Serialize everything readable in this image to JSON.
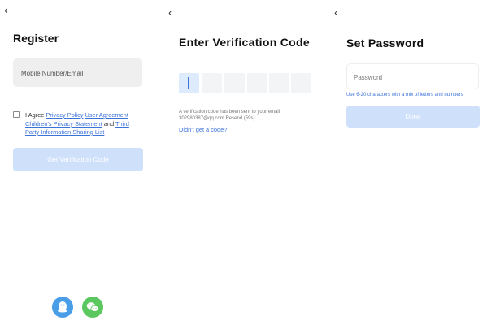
{
  "register": {
    "title": "Register",
    "input_placeholder": "Mobile Number/Email",
    "agree_prefix": "I Agree",
    "privacy_policy": "Privacy Policy",
    "user_agreement": "User Agreement",
    "children_privacy": "Children's Privacy Statement",
    "and": "and",
    "third_party": "Third Party Information Sharing List",
    "submit_label": "Get Verification Code",
    "social": [
      {
        "icon": "qq-icon",
        "color": "#4a9ee8"
      },
      {
        "icon": "wechat-icon",
        "color": "#5bc75f"
      }
    ]
  },
  "verify": {
    "title": "Enter Verification Code",
    "code_boxes": 6,
    "info_text": "A verification code has been sent to your email 302980387@qq.com Resend (59s)",
    "resend_link": "Didn't get a code?"
  },
  "password": {
    "title": "Set Password",
    "input_placeholder": "Password",
    "hint": "Use 6-20 characters with a mix of letters and numbers",
    "submit_label": "Done"
  },
  "colors": {
    "accent": "#3b73d9",
    "button_disabled": "#cfe0fb",
    "input_bg": "#efefef",
    "code_box_bg": "#f3f4f6"
  }
}
